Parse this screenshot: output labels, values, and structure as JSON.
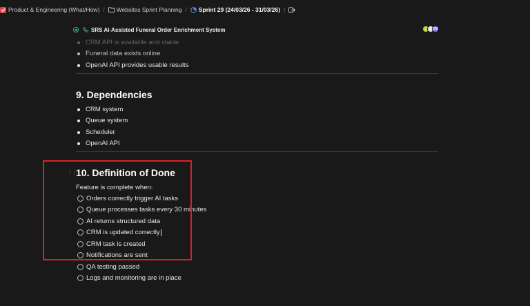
{
  "breadcrumb": {
    "items": [
      {
        "label": "Product & Engineering (What/How)",
        "icon": "space-icon"
      },
      {
        "label": "Websites Sprint Planning",
        "icon": "folder-icon"
      },
      {
        "label": "Sprint 29 (24/03/26 - 31/03/26)",
        "icon": "sprint-icon",
        "active": true
      }
    ],
    "separator": "/"
  },
  "document": {
    "title": "SRS AI-Assisted Funeral Order Enrichment System",
    "assumptions": [
      "CRM API is available and stable",
      "Funeral data exists online",
      "OpenAI API provides usable results"
    ],
    "dependencies": {
      "heading": "9. Dependencies",
      "items": [
        "CRM system",
        "Queue system",
        "Scheduler",
        "OpenAI API"
      ]
    },
    "definition_of_done": {
      "heading": "10. Definition of Done",
      "intro": "Feature is complete when:",
      "checklist": [
        "Orders correctly trigger AI tasks",
        "Queue processes tasks every 30 minutes",
        "AI returns structured data",
        "CRM is updated correctly",
        "CRM task is created",
        "Notifications are sent",
        "QA testing passed",
        "Logs and monitoring are in place"
      ]
    }
  },
  "colors": {
    "background": "#191919",
    "status_green": "#3fb877",
    "highlight_red": "#d8222a",
    "avatar_1": "#c9d63a",
    "avatar_2": "#e8e8e8",
    "avatar_3": "#8b7cf6"
  },
  "avatars": {
    "a3_initials": "DV"
  }
}
